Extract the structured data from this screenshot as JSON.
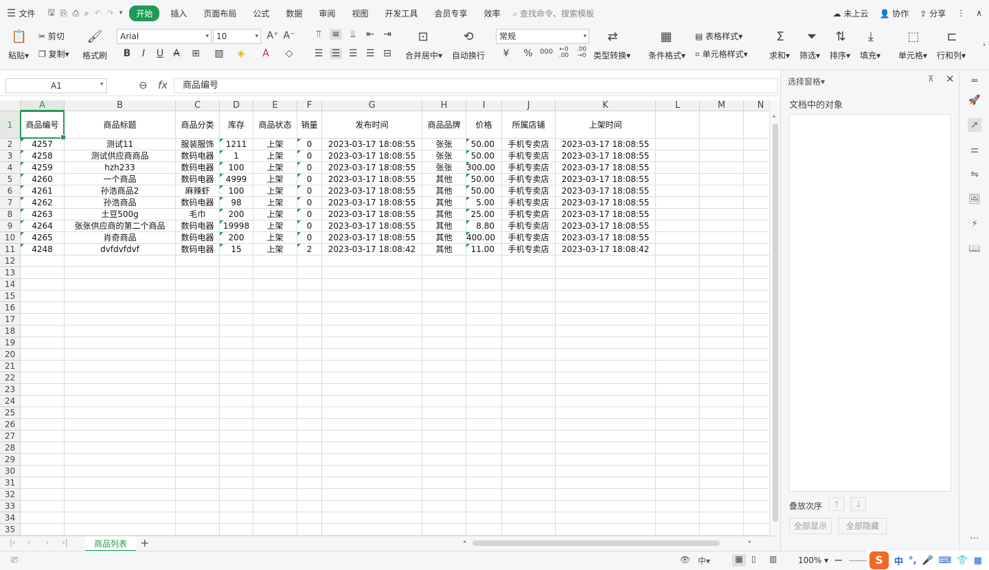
{
  "menu": {
    "file": "文件",
    "tabs": [
      "开始",
      "插入",
      "页面布局",
      "公式",
      "数据",
      "审阅",
      "视图",
      "开发工具",
      "会员专享",
      "效率"
    ],
    "search_placeholder": "查找命令、搜索模板",
    "cloud": "未上云",
    "collab": "协作",
    "share": "分享"
  },
  "ribbon": {
    "paste": "粘贴",
    "cut": "剪切",
    "copy": "复制",
    "format_painter": "格式刷",
    "font_name": "Arial",
    "font_size": "10",
    "merge_center": "合并居中",
    "wrap": "自动换行",
    "number_format": "常规",
    "type_convert": "类型转换",
    "cond_format": "条件格式",
    "table_style": "表格样式",
    "cell_style": "单元格样式",
    "sum": "求和",
    "filter": "筛选",
    "sort": "排序",
    "fill": "填充",
    "cell": "单元格",
    "rowcol": "行和列",
    "currency": "¥",
    "percent": "%",
    "thousands": "000",
    "inc_dec": "←0 .00",
    "dec_dec": ".00 →0"
  },
  "formula_bar": {
    "name_box": "A1",
    "fx": "fx",
    "content": "商品编号"
  },
  "sheet": {
    "columns": [
      "A",
      "B",
      "C",
      "D",
      "E",
      "F",
      "G",
      "H",
      "I",
      "J",
      "K",
      "L",
      "M",
      "N"
    ],
    "headers": [
      "商品编号",
      "商品标题",
      "商品分类",
      "库存",
      "商品状态",
      "销量",
      "发布时间",
      "商品品牌",
      "价格",
      "所属店铺",
      "上架时间"
    ],
    "rows": [
      [
        "4257",
        "测试11",
        "服装服饰",
        "1211",
        "上架",
        "0",
        "2023-03-17 18:08:55",
        "张张",
        "50.00",
        "手机专卖店",
        "2023-03-17 18:08:55"
      ],
      [
        "4258",
        "测试供应商商品",
        "数码电器",
        "1",
        "上架",
        "0",
        "2023-03-17 18:08:55",
        "张张",
        "50.00",
        "手机专卖店",
        "2023-03-17 18:08:55"
      ],
      [
        "4259",
        "hzh233",
        "数码电器",
        "100",
        "上架",
        "0",
        "2023-03-17 18:08:55",
        "张张",
        "300.00",
        "手机专卖店",
        "2023-03-17 18:08:55"
      ],
      [
        "4260",
        "一个商品",
        "数码电器",
        "4999",
        "上架",
        "0",
        "2023-03-17 18:08:55",
        "其他",
        "50.00",
        "手机专卖店",
        "2023-03-17 18:08:55"
      ],
      [
        "4261",
        "孙浩商品2",
        "麻辣虾",
        "100",
        "上架",
        "0",
        "2023-03-17 18:08:55",
        "其他",
        "50.00",
        "手机专卖店",
        "2023-03-17 18:08:55"
      ],
      [
        "4262",
        "孙浩商品",
        "数码电器",
        "98",
        "上架",
        "0",
        "2023-03-17 18:08:55",
        "其他",
        "5.00",
        "手机专卖店",
        "2023-03-17 18:08:55"
      ],
      [
        "4263",
        "土豆500g",
        "毛巾",
        "200",
        "上架",
        "0",
        "2023-03-17 18:08:55",
        "其他",
        "25.00",
        "手机专卖店",
        "2023-03-17 18:08:55"
      ],
      [
        "4264",
        "张张供应商的第二个商品",
        "数码电器",
        "19998",
        "上架",
        "0",
        "2023-03-17 18:08:55",
        "其他",
        "8.80",
        "手机专卖店",
        "2023-03-17 18:08:55"
      ],
      [
        "4265",
        "肖奇商品",
        "数码电器",
        "200",
        "上架",
        "0",
        "2023-03-17 18:08:55",
        "其他",
        "400.00",
        "手机专卖店",
        "2023-03-17 18:08:55"
      ],
      [
        "4248",
        "dvfdvfdvf",
        "数码电器",
        "15",
        "上架",
        "2",
        "2023-03-17 18:08:42",
        "其他",
        "11.00",
        "手机专卖店",
        "2023-03-17 18:08:42"
      ]
    ],
    "tab_name": "商品列表"
  },
  "pane": {
    "title": "选择窗格",
    "objects_label": "文档中的对象",
    "order_label": "叠放次序",
    "show_all": "全部显示",
    "hide_all": "全部隐藏"
  },
  "status": {
    "zoom": "100%"
  },
  "ime": {
    "logo": "S",
    "zh": "中"
  }
}
